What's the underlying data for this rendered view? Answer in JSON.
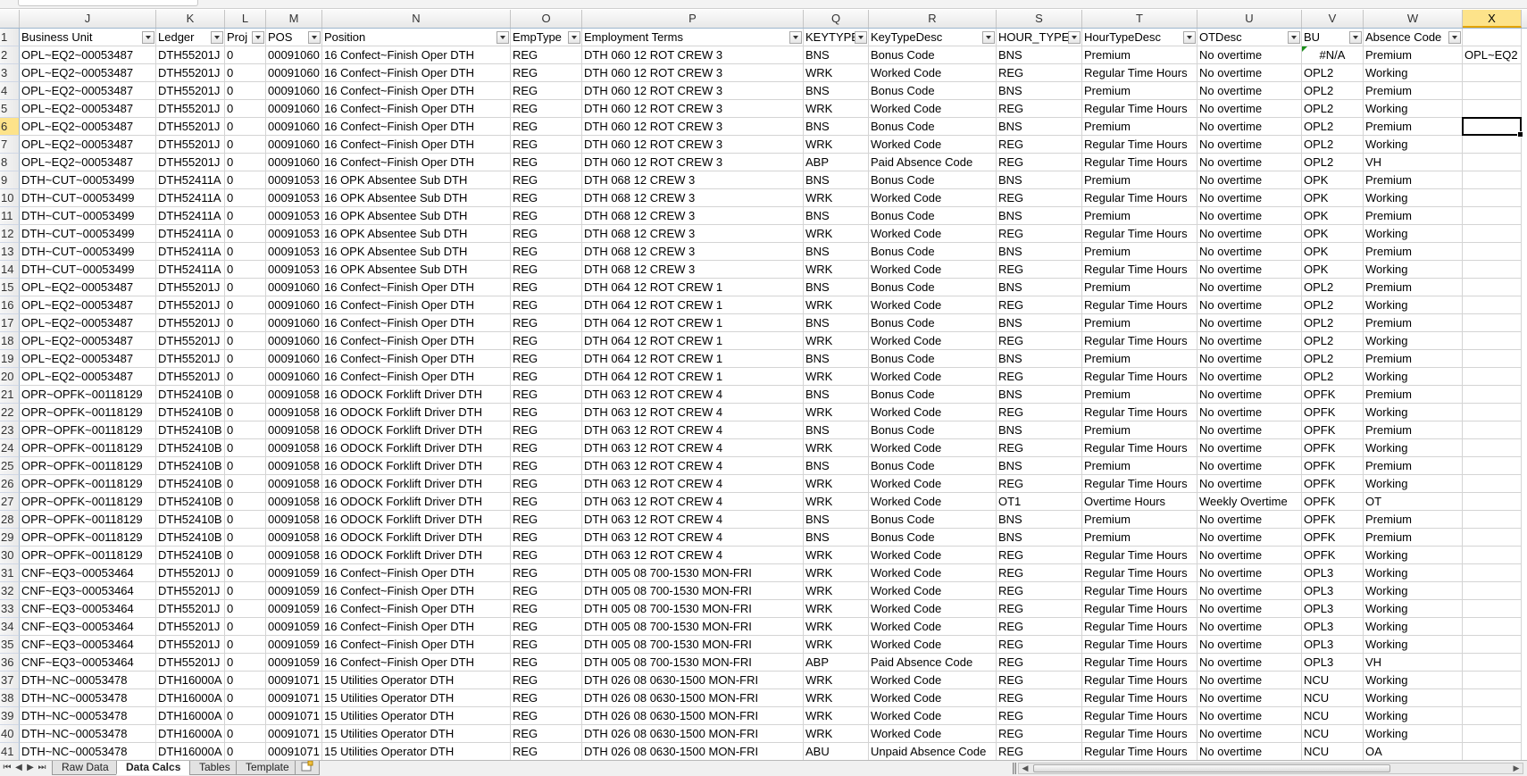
{
  "columns": [
    {
      "letter": "J",
      "header": "Business Unit",
      "key": "bu_full",
      "width": 153
    },
    {
      "letter": "K",
      "header": "Ledger",
      "key": "ledger",
      "width": 77
    },
    {
      "letter": "L",
      "header": "Proj",
      "key": "proj",
      "width": 46
    },
    {
      "letter": "M",
      "header": "POS",
      "key": "pos",
      "width": 63
    },
    {
      "letter": "N",
      "header": "Position",
      "key": "position",
      "width": 211
    },
    {
      "letter": "O",
      "header": "EmpType",
      "key": "emptype",
      "width": 80
    },
    {
      "letter": "P",
      "header": "Employment Terms",
      "key": "terms",
      "width": 248
    },
    {
      "letter": "Q",
      "header": "KEYTYPE",
      "key": "keytype",
      "width": 73
    },
    {
      "letter": "R",
      "header": "KeyTypeDesc",
      "key": "keydesc",
      "width": 143
    },
    {
      "letter": "S",
      "header": "HOUR_TYPE",
      "key": "hourtype",
      "width": 96
    },
    {
      "letter": "T",
      "header": "HourTypeDesc",
      "key": "hourdesc",
      "width": 129
    },
    {
      "letter": "U",
      "header": "OTDesc",
      "key": "otdesc",
      "width": 117
    },
    {
      "letter": "V",
      "header": "BU",
      "key": "bu",
      "width": 69
    },
    {
      "letter": "W",
      "header": "Absence Code",
      "key": "absence",
      "width": 111
    },
    {
      "letter": "X",
      "header": "",
      "key": "x",
      "width": 66
    }
  ],
  "selected_column": "X",
  "selected_row": 6,
  "rows": [
    [
      "OPL~EQ2~00053487",
      "DTH55201J",
      "0",
      "00091060",
      "16 Confect~Finish Oper DTH",
      "REG",
      "DTH 060 12 ROT CREW 3",
      "BNS",
      "Bonus Code",
      "BNS",
      "Premium",
      "No overtime",
      "#N/A",
      "Premium",
      "OPL~EQ2"
    ],
    [
      "OPL~EQ2~00053487",
      "DTH55201J",
      "0",
      "00091060",
      "16 Confect~Finish Oper DTH",
      "REG",
      "DTH 060 12 ROT CREW 3",
      "WRK",
      "Worked Code",
      "REG",
      "Regular Time Hours",
      "No overtime",
      "OPL2",
      "Working",
      ""
    ],
    [
      "OPL~EQ2~00053487",
      "DTH55201J",
      "0",
      "00091060",
      "16 Confect~Finish Oper DTH",
      "REG",
      "DTH 060 12 ROT CREW 3",
      "BNS",
      "Bonus Code",
      "BNS",
      "Premium",
      "No overtime",
      "OPL2",
      "Premium",
      ""
    ],
    [
      "OPL~EQ2~00053487",
      "DTH55201J",
      "0",
      "00091060",
      "16 Confect~Finish Oper DTH",
      "REG",
      "DTH 060 12 ROT CREW 3",
      "WRK",
      "Worked Code",
      "REG",
      "Regular Time Hours",
      "No overtime",
      "OPL2",
      "Working",
      ""
    ],
    [
      "OPL~EQ2~00053487",
      "DTH55201J",
      "0",
      "00091060",
      "16 Confect~Finish Oper DTH",
      "REG",
      "DTH 060 12 ROT CREW 3",
      "BNS",
      "Bonus Code",
      "BNS",
      "Premium",
      "No overtime",
      "OPL2",
      "Premium",
      ""
    ],
    [
      "OPL~EQ2~00053487",
      "DTH55201J",
      "0",
      "00091060",
      "16 Confect~Finish Oper DTH",
      "REG",
      "DTH 060 12 ROT CREW 3",
      "WRK",
      "Worked Code",
      "REG",
      "Regular Time Hours",
      "No overtime",
      "OPL2",
      "Working",
      ""
    ],
    [
      "OPL~EQ2~00053487",
      "DTH55201J",
      "0",
      "00091060",
      "16 Confect~Finish Oper DTH",
      "REG",
      "DTH 060 12 ROT CREW 3",
      "ABP",
      "Paid Absence Code",
      "REG",
      "Regular Time Hours",
      "No overtime",
      "OPL2",
      "VH",
      ""
    ],
    [
      "DTH~CUT~00053499",
      "DTH52411A",
      "0",
      "00091053",
      "16 OPK Absentee Sub DTH",
      "REG",
      "DTH 068 12 CREW 3",
      "BNS",
      "Bonus Code",
      "BNS",
      "Premium",
      "No overtime",
      "OPK",
      "Premium",
      ""
    ],
    [
      "DTH~CUT~00053499",
      "DTH52411A",
      "0",
      "00091053",
      "16 OPK Absentee Sub DTH",
      "REG",
      "DTH 068 12 CREW 3",
      "WRK",
      "Worked Code",
      "REG",
      "Regular Time Hours",
      "No overtime",
      "OPK",
      "Working",
      ""
    ],
    [
      "DTH~CUT~00053499",
      "DTH52411A",
      "0",
      "00091053",
      "16 OPK Absentee Sub DTH",
      "REG",
      "DTH 068 12 CREW 3",
      "BNS",
      "Bonus Code",
      "BNS",
      "Premium",
      "No overtime",
      "OPK",
      "Premium",
      ""
    ],
    [
      "DTH~CUT~00053499",
      "DTH52411A",
      "0",
      "00091053",
      "16 OPK Absentee Sub DTH",
      "REG",
      "DTH 068 12 CREW 3",
      "WRK",
      "Worked Code",
      "REG",
      "Regular Time Hours",
      "No overtime",
      "OPK",
      "Working",
      ""
    ],
    [
      "DTH~CUT~00053499",
      "DTH52411A",
      "0",
      "00091053",
      "16 OPK Absentee Sub DTH",
      "REG",
      "DTH 068 12 CREW 3",
      "BNS",
      "Bonus Code",
      "BNS",
      "Premium",
      "No overtime",
      "OPK",
      "Premium",
      ""
    ],
    [
      "DTH~CUT~00053499",
      "DTH52411A",
      "0",
      "00091053",
      "16 OPK Absentee Sub DTH",
      "REG",
      "DTH 068 12 CREW 3",
      "WRK",
      "Worked Code",
      "REG",
      "Regular Time Hours",
      "No overtime",
      "OPK",
      "Working",
      ""
    ],
    [
      "OPL~EQ2~00053487",
      "DTH55201J",
      "0",
      "00091060",
      "16 Confect~Finish Oper DTH",
      "REG",
      "DTH 064 12 ROT CREW 1",
      "BNS",
      "Bonus Code",
      "BNS",
      "Premium",
      "No overtime",
      "OPL2",
      "Premium",
      ""
    ],
    [
      "OPL~EQ2~00053487",
      "DTH55201J",
      "0",
      "00091060",
      "16 Confect~Finish Oper DTH",
      "REG",
      "DTH 064 12 ROT CREW 1",
      "WRK",
      "Worked Code",
      "REG",
      "Regular Time Hours",
      "No overtime",
      "OPL2",
      "Working",
      ""
    ],
    [
      "OPL~EQ2~00053487",
      "DTH55201J",
      "0",
      "00091060",
      "16 Confect~Finish Oper DTH",
      "REG",
      "DTH 064 12 ROT CREW 1",
      "BNS",
      "Bonus Code",
      "BNS",
      "Premium",
      "No overtime",
      "OPL2",
      "Premium",
      ""
    ],
    [
      "OPL~EQ2~00053487",
      "DTH55201J",
      "0",
      "00091060",
      "16 Confect~Finish Oper DTH",
      "REG",
      "DTH 064 12 ROT CREW 1",
      "WRK",
      "Worked Code",
      "REG",
      "Regular Time Hours",
      "No overtime",
      "OPL2",
      "Working",
      ""
    ],
    [
      "OPL~EQ2~00053487",
      "DTH55201J",
      "0",
      "00091060",
      "16 Confect~Finish Oper DTH",
      "REG",
      "DTH 064 12 ROT CREW 1",
      "BNS",
      "Bonus Code",
      "BNS",
      "Premium",
      "No overtime",
      "OPL2",
      "Premium",
      ""
    ],
    [
      "OPL~EQ2~00053487",
      "DTH55201J",
      "0",
      "00091060",
      "16 Confect~Finish Oper DTH",
      "REG",
      "DTH 064 12 ROT CREW 1",
      "WRK",
      "Worked Code",
      "REG",
      "Regular Time Hours",
      "No overtime",
      "OPL2",
      "Working",
      ""
    ],
    [
      "OPR~OPFK~00118129",
      "DTH52410B",
      "0",
      "00091058",
      "16 ODOCK Forklift Driver DTH",
      "REG",
      "DTH 063 12 ROT CREW 4",
      "BNS",
      "Bonus Code",
      "BNS",
      "Premium",
      "No overtime",
      "OPFK",
      "Premium",
      ""
    ],
    [
      "OPR~OPFK~00118129",
      "DTH52410B",
      "0",
      "00091058",
      "16 ODOCK Forklift Driver DTH",
      "REG",
      "DTH 063 12 ROT CREW 4",
      "WRK",
      "Worked Code",
      "REG",
      "Regular Time Hours",
      "No overtime",
      "OPFK",
      "Working",
      ""
    ],
    [
      "OPR~OPFK~00118129",
      "DTH52410B",
      "0",
      "00091058",
      "16 ODOCK Forklift Driver DTH",
      "REG",
      "DTH 063 12 ROT CREW 4",
      "BNS",
      "Bonus Code",
      "BNS",
      "Premium",
      "No overtime",
      "OPFK",
      "Premium",
      ""
    ],
    [
      "OPR~OPFK~00118129",
      "DTH52410B",
      "0",
      "00091058",
      "16 ODOCK Forklift Driver DTH",
      "REG",
      "DTH 063 12 ROT CREW 4",
      "WRK",
      "Worked Code",
      "REG",
      "Regular Time Hours",
      "No overtime",
      "OPFK",
      "Working",
      ""
    ],
    [
      "OPR~OPFK~00118129",
      "DTH52410B",
      "0",
      "00091058",
      "16 ODOCK Forklift Driver DTH",
      "REG",
      "DTH 063 12 ROT CREW 4",
      "BNS",
      "Bonus Code",
      "BNS",
      "Premium",
      "No overtime",
      "OPFK",
      "Premium",
      ""
    ],
    [
      "OPR~OPFK~00118129",
      "DTH52410B",
      "0",
      "00091058",
      "16 ODOCK Forklift Driver DTH",
      "REG",
      "DTH 063 12 ROT CREW 4",
      "WRK",
      "Worked Code",
      "REG",
      "Regular Time Hours",
      "No overtime",
      "OPFK",
      "Working",
      ""
    ],
    [
      "OPR~OPFK~00118129",
      "DTH52410B",
      "0",
      "00091058",
      "16 ODOCK Forklift Driver DTH",
      "REG",
      "DTH 063 12 ROT CREW 4",
      "WRK",
      "Worked Code",
      "OT1",
      "Overtime Hours",
      "Weekly Overtime",
      "OPFK",
      "OT",
      ""
    ],
    [
      "OPR~OPFK~00118129",
      "DTH52410B",
      "0",
      "00091058",
      "16 ODOCK Forklift Driver DTH",
      "REG",
      "DTH 063 12 ROT CREW 4",
      "BNS",
      "Bonus Code",
      "BNS",
      "Premium",
      "No overtime",
      "OPFK",
      "Premium",
      ""
    ],
    [
      "OPR~OPFK~00118129",
      "DTH52410B",
      "0",
      "00091058",
      "16 ODOCK Forklift Driver DTH",
      "REG",
      "DTH 063 12 ROT CREW 4",
      "BNS",
      "Bonus Code",
      "BNS",
      "Premium",
      "No overtime",
      "OPFK",
      "Premium",
      ""
    ],
    [
      "OPR~OPFK~00118129",
      "DTH52410B",
      "0",
      "00091058",
      "16 ODOCK Forklift Driver DTH",
      "REG",
      "DTH 063 12 ROT CREW 4",
      "WRK",
      "Worked Code",
      "REG",
      "Regular Time Hours",
      "No overtime",
      "OPFK",
      "Working",
      ""
    ],
    [
      "CNF~EQ3~00053464",
      "DTH55201J",
      "0",
      "00091059",
      "16 Confect~Finish Oper DTH",
      "REG",
      "DTH 005 08 700-1530 MON-FRI",
      "WRK",
      "Worked Code",
      "REG",
      "Regular Time Hours",
      "No overtime",
      "OPL3",
      "Working",
      ""
    ],
    [
      "CNF~EQ3~00053464",
      "DTH55201J",
      "0",
      "00091059",
      "16 Confect~Finish Oper DTH",
      "REG",
      "DTH 005 08 700-1530 MON-FRI",
      "WRK",
      "Worked Code",
      "REG",
      "Regular Time Hours",
      "No overtime",
      "OPL3",
      "Working",
      ""
    ],
    [
      "CNF~EQ3~00053464",
      "DTH55201J",
      "0",
      "00091059",
      "16 Confect~Finish Oper DTH",
      "REG",
      "DTH 005 08 700-1530 MON-FRI",
      "WRK",
      "Worked Code",
      "REG",
      "Regular Time Hours",
      "No overtime",
      "OPL3",
      "Working",
      ""
    ],
    [
      "CNF~EQ3~00053464",
      "DTH55201J",
      "0",
      "00091059",
      "16 Confect~Finish Oper DTH",
      "REG",
      "DTH 005 08 700-1530 MON-FRI",
      "WRK",
      "Worked Code",
      "REG",
      "Regular Time Hours",
      "No overtime",
      "OPL3",
      "Working",
      ""
    ],
    [
      "CNF~EQ3~00053464",
      "DTH55201J",
      "0",
      "00091059",
      "16 Confect~Finish Oper DTH",
      "REG",
      "DTH 005 08 700-1530 MON-FRI",
      "WRK",
      "Worked Code",
      "REG",
      "Regular Time Hours",
      "No overtime",
      "OPL3",
      "Working",
      ""
    ],
    [
      "CNF~EQ3~00053464",
      "DTH55201J",
      "0",
      "00091059",
      "16 Confect~Finish Oper DTH",
      "REG",
      "DTH 005 08 700-1530 MON-FRI",
      "ABP",
      "Paid Absence Code",
      "REG",
      "Regular Time Hours",
      "No overtime",
      "OPL3",
      "VH",
      ""
    ],
    [
      "DTH~NC~00053478",
      "DTH16000A",
      "0",
      "00091071",
      "15 Utilities Operator DTH",
      "REG",
      "DTH 026 08 0630-1500 MON-FRI",
      "WRK",
      "Worked Code",
      "REG",
      "Regular Time Hours",
      "No overtime",
      "NCU",
      "Working",
      ""
    ],
    [
      "DTH~NC~00053478",
      "DTH16000A",
      "0",
      "00091071",
      "15 Utilities Operator DTH",
      "REG",
      "DTH 026 08 0630-1500 MON-FRI",
      "WRK",
      "Worked Code",
      "REG",
      "Regular Time Hours",
      "No overtime",
      "NCU",
      "Working",
      ""
    ],
    [
      "DTH~NC~00053478",
      "DTH16000A",
      "0",
      "00091071",
      "15 Utilities Operator DTH",
      "REG",
      "DTH 026 08 0630-1500 MON-FRI",
      "WRK",
      "Worked Code",
      "REG",
      "Regular Time Hours",
      "No overtime",
      "NCU",
      "Working",
      ""
    ],
    [
      "DTH~NC~00053478",
      "DTH16000A",
      "0",
      "00091071",
      "15 Utilities Operator DTH",
      "REG",
      "DTH 026 08 0630-1500 MON-FRI",
      "WRK",
      "Worked Code",
      "REG",
      "Regular Time Hours",
      "No overtime",
      "NCU",
      "Working",
      ""
    ],
    [
      "DTH~NC~00053478",
      "DTH16000A",
      "0",
      "00091071",
      "15 Utilities Operator DTH",
      "REG",
      "DTH 026 08 0630-1500 MON-FRI",
      "ABU",
      "Unpaid Absence Code",
      "REG",
      "Regular Time Hours",
      "No overtime",
      "NCU",
      "OA",
      ""
    ]
  ],
  "sheet_tabs": [
    "Raw Data",
    "Data Calcs",
    "Tables",
    "Template"
  ],
  "active_tab": "Data Calcs",
  "nav_buttons": [
    "⏮",
    "◀",
    "▶",
    "⏭"
  ],
  "colors": {
    "header_sel": "#fde38a",
    "grid": "#d4d4d4"
  }
}
